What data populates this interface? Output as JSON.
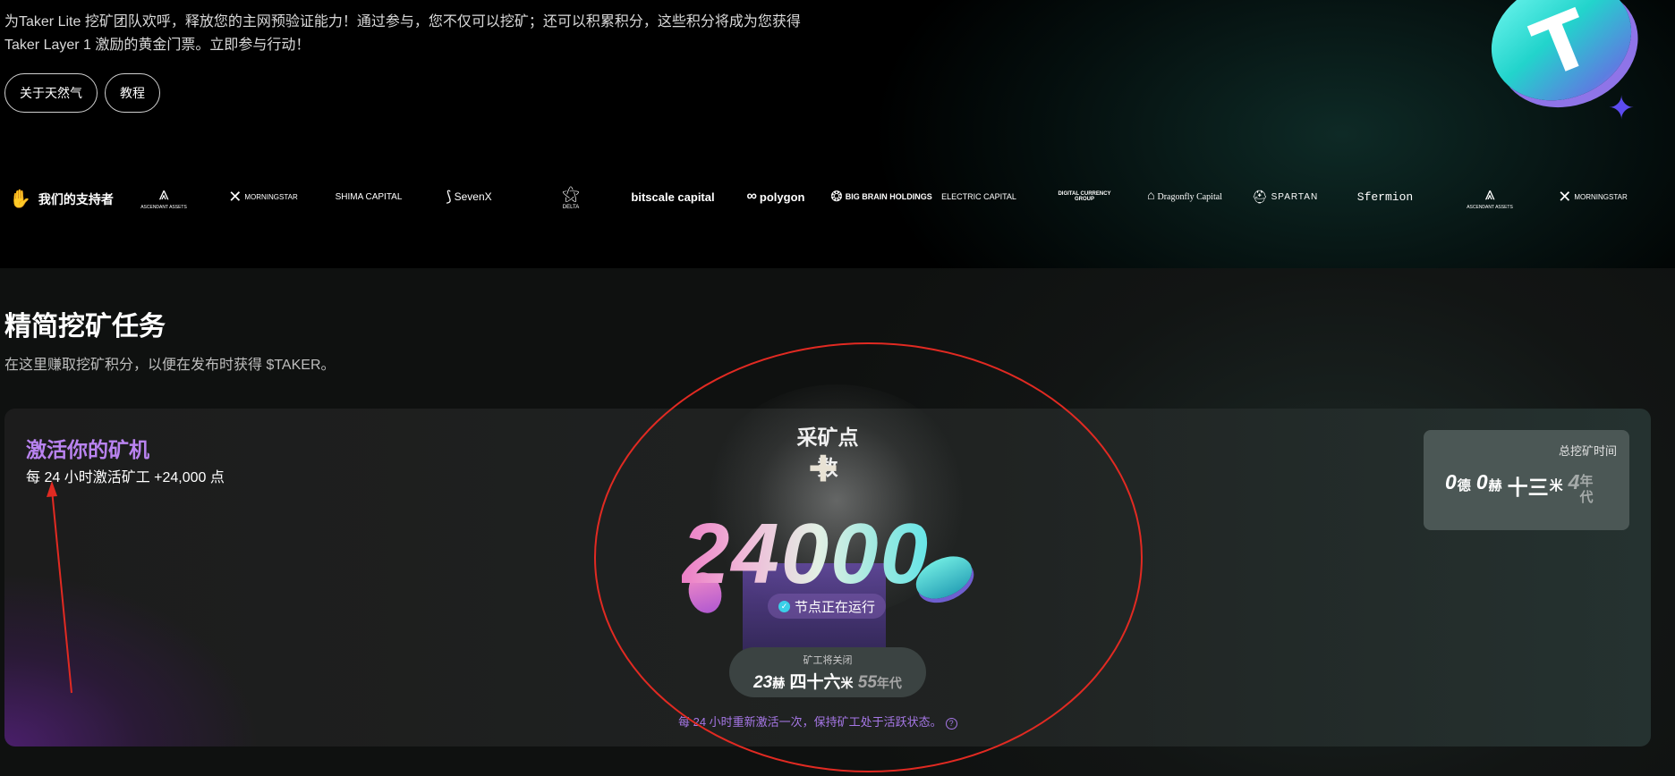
{
  "intro": {
    "line1": "为Taker Lite 挖矿团队欢呼，释放您的主网预验证能力！通过参与，您不仅可以挖矿；还可以积累积分，这些积分将成为您获得",
    "line2": "Taker Layer 1 激励的黄金门票。立即参与行动！"
  },
  "buttons": {
    "about": "关于天然气",
    "tutorial": "教程"
  },
  "sponsors": {
    "title": "我们的支持者",
    "logos": [
      {
        "name": "ascendant-assets",
        "text": "ASCENDANT ASSETS"
      },
      {
        "name": "morningstar-ventures",
        "text": "MORNINGSTAR"
      },
      {
        "name": "shima-capital",
        "text": "SHIMA CAPITAL"
      },
      {
        "name": "sevenx-ventures",
        "text": "SevenX"
      },
      {
        "name": "delta",
        "text": "DELTA"
      },
      {
        "name": "bitscale-capital",
        "text": "bitscale capital"
      },
      {
        "name": "polygon",
        "text": "polygon"
      },
      {
        "name": "big-brain-holdings",
        "text": "BIG BRAIN HOLDINGS"
      },
      {
        "name": "electric-capital",
        "text": "ELECTRIC CAPITAL"
      },
      {
        "name": "digital-currency-group",
        "text": "DIGITAL CURRENCY GROUP"
      },
      {
        "name": "dragonfly-capital",
        "text": "Dragonfly Capital"
      },
      {
        "name": "spartan",
        "text": "SPARTAN"
      },
      {
        "name": "sfermion",
        "text": "Sfermion"
      },
      {
        "name": "ascendant-assets-2",
        "text": "ASCENDANT ASSETS"
      },
      {
        "name": "morningstar-ventures-2",
        "text": "MORNINGSTAR"
      }
    ]
  },
  "section": {
    "title": "精简挖矿任务",
    "subtitle": "在这里赚取挖矿积分，以便在发布时获得 $TAKER。"
  },
  "card": {
    "title": "激活你的矿机",
    "subtitle": "每 24 小时激活矿工 +24,000 点",
    "mining_label": "采矿点数",
    "plus": "+",
    "points": "24000",
    "status": "节点正在运行",
    "close_label": "矿工将关闭",
    "close_time": {
      "h": "23",
      "h_unit": "赫",
      "m": "四十六",
      "m_unit": "米",
      "s": "55",
      "s_unit": "年代"
    },
    "note": "每 24 小时重新激活一次，保持矿工处于活跃状态。",
    "total_label": "总挖矿时间",
    "total_time": {
      "d": "0",
      "d_unit": "德",
      "h": "0",
      "h_unit": "赫",
      "m": "十三",
      "m_unit": "米",
      "s": "4",
      "s_unit": "年代"
    }
  },
  "colors": {
    "accent_purple": "#b983f0",
    "annotation_red": "#e12a22",
    "coin_cyan": "#22d4cc"
  }
}
